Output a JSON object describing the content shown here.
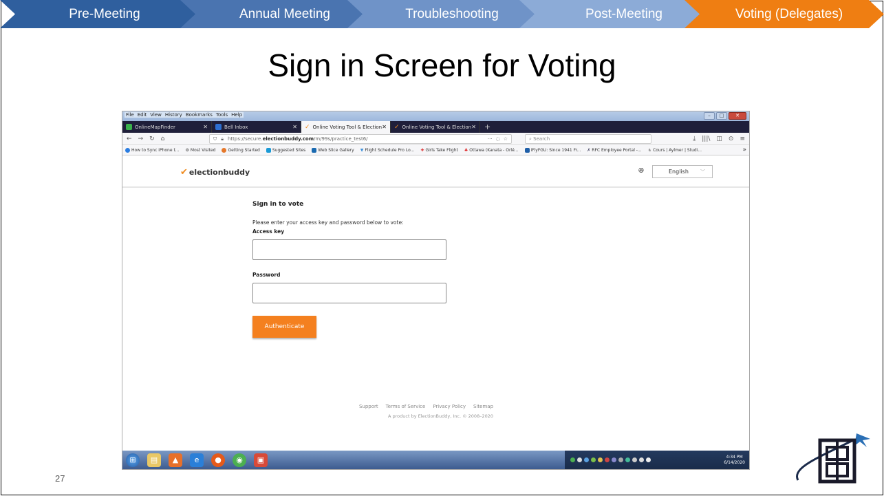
{
  "progress": {
    "steps": [
      {
        "label": "Pre-Meeting",
        "color": "#2f5f9e"
      },
      {
        "label": "Annual Meeting",
        "color": "#4a74b0"
      },
      {
        "label": "Troubleshooting",
        "color": "#6f93c8"
      },
      {
        "label": "Post-Meeting",
        "color": "#8cabd7"
      },
      {
        "label": "Voting (Delegates)",
        "color": "#ef7e12"
      }
    ]
  },
  "slide": {
    "title": "Sign in Screen for Voting",
    "page_number": "27"
  },
  "browser": {
    "menu": [
      "File",
      "Edit",
      "View",
      "History",
      "Bookmarks",
      "Tools",
      "Help"
    ],
    "tabs": [
      {
        "label": "OnlineMapFinder",
        "icon": "map-icon",
        "active": false
      },
      {
        "label": "Bell Inbox",
        "icon": "mail-icon",
        "active": false
      },
      {
        "label": "Online Voting Tool & Election",
        "icon": "electionbuddy-icon",
        "active": true
      },
      {
        "label": "Online Voting Tool & Election",
        "icon": "electionbuddy-icon",
        "active": false
      }
    ],
    "url_prefix": "https://secure.",
    "url_domain": "electionbuddy.com",
    "url_path": "/m/99s/practice_test6/",
    "search_placeholder": "Search",
    "bookmarks": [
      "How to Sync iPhone t...",
      "Most Visited",
      "Getting Started",
      "Suggested Sites",
      "Web Slice Gallery",
      "Flight Schedule Pro Lo...",
      "Girls Take Flight",
      "Ottawa (Kanata - Orlé...",
      "iFlyFGU: Since 1941 Fr...",
      "RFC Employee Portal -...",
      "Cours | Aylmer | Studi..."
    ]
  },
  "site": {
    "logo": "electionbuddy",
    "language": "English",
    "heading": "Sign in to vote",
    "instructions": "Please enter your access key and password below to vote:",
    "access_key_label": "Access key",
    "password_label": "Password",
    "submit_label": "Authenticate",
    "footer_links": [
      "Support",
      "Terms of Service",
      "Privacy Policy",
      "Sitemap"
    ],
    "copyright": "A product by ElectionBuddy, Inc. © 2008–2020"
  },
  "taskbar": {
    "time": "4:34 PM",
    "date": "6/14/2020"
  }
}
